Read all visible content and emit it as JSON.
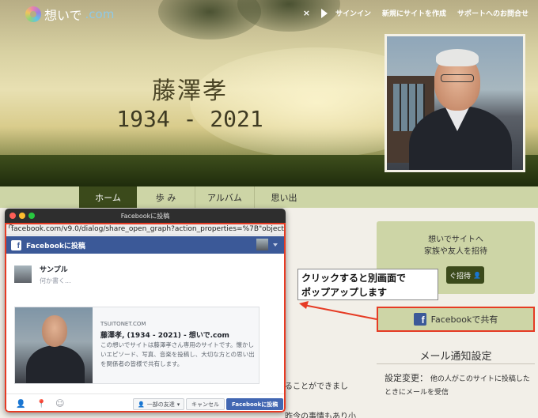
{
  "site": {
    "logo_name": "想いで",
    "logo_domain": ".com",
    "nav": [
      {
        "label": "サインイン"
      },
      {
        "label": "新規にサイトを作成"
      },
      {
        "label": "サポートへのお問合せ"
      }
    ],
    "close_glyph": "×"
  },
  "hero": {
    "name": "藤澤孝",
    "years": "1934 - 2021"
  },
  "tabs": [
    {
      "label": "ホーム",
      "active": true
    },
    {
      "label": "歩 み",
      "active": false
    },
    {
      "label": "アルバム",
      "active": false
    },
    {
      "label": "思い出",
      "active": false
    }
  ],
  "invite": {
    "line1": "想いでサイトへ",
    "line2": "家族や友人を招待",
    "button_label": "ぐ招待"
  },
  "share": {
    "label": "Facebookで共有"
  },
  "mail": {
    "title": "メール通知設定",
    "setting_label": "設定変更：",
    "setting_text": "他の人がこのサイトに投稿したときにメールを受信"
  },
  "body": {
    "text1": "ることができまし",
    "text2": "昨今の事情もあり小"
  },
  "callout": {
    "line1": "クリックすると別画面で",
    "line2": "ポップアップします"
  },
  "popup": {
    "window_title": "Facebookに投稿",
    "url": "facebook.com/v9.0/dialog/share_open_graph?action_properties=%7B\"object...",
    "header_title": "Facebookに投稿",
    "user_name": "サンプル",
    "compose_placeholder": "何か書く...",
    "card": {
      "domain": "TSUITONET.COM",
      "title": "藤澤孝, (1934 - 2021) - 想いで.com",
      "description": "この想いでサイトは藤澤孝さん専用のサイトです。懐かしいエピソード、写真、音楽を投稿し、大切な方との思い出を関係者の皆様で共有します。"
    },
    "audience_label": "一部の友達",
    "cancel_label": "キャンセル",
    "post_label": "Facebookに投稿"
  },
  "icons": {
    "fb": "f",
    "tag_friends": "👤",
    "location": "📍",
    "feeling": "☺"
  },
  "colors": {
    "nav_band": "#cdd5a6",
    "active_tab": "#3b4a1b",
    "facebook_blue": "#3b5998",
    "highlight_red": "#e63b24"
  }
}
